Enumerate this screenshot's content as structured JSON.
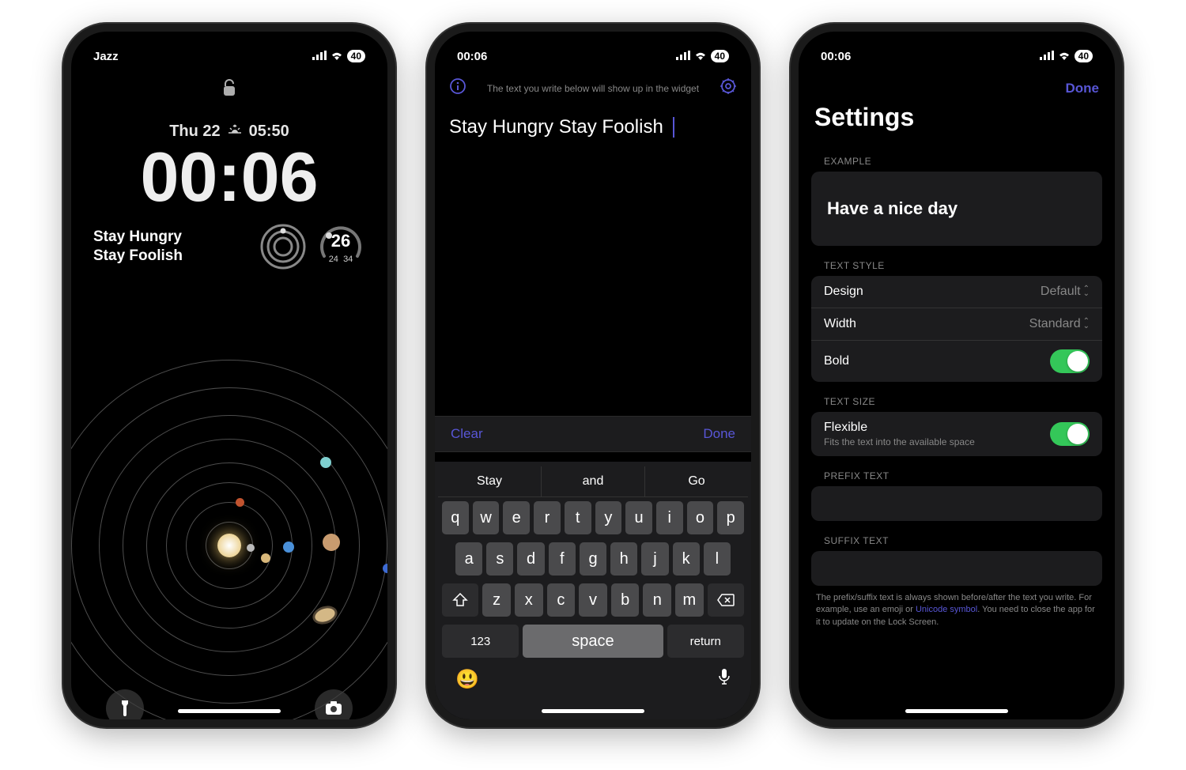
{
  "status": {
    "carrier": "Jazz",
    "time": "00:06",
    "battery": "40"
  },
  "lockscreen": {
    "date": "Thu 22",
    "sunrise": "05:50",
    "time": "00:06",
    "widget_text_l1": "Stay Hungry",
    "widget_text_l2": "Stay Foolish ",
    "gauge": {
      "main": "26",
      "low": "24",
      "high": "34"
    }
  },
  "editor": {
    "hint": "The text you write below will show up in the widget",
    "text": "Stay Hungry Stay Foolish ",
    "toolbar": {
      "clear": "Clear",
      "done": "Done"
    },
    "suggestions": [
      "Stay",
      "and",
      "Go"
    ],
    "keys": {
      "row1": [
        "q",
        "w",
        "e",
        "r",
        "t",
        "y",
        "u",
        "i",
        "o",
        "p"
      ],
      "row2": [
        "a",
        "s",
        "d",
        "f",
        "g",
        "h",
        "j",
        "k",
        "l"
      ],
      "row3": [
        "z",
        "x",
        "c",
        "v",
        "b",
        "n",
        "m"
      ],
      "numbers": "123",
      "space": "space",
      "return": "return"
    }
  },
  "settings": {
    "done": "Done",
    "title": "Settings",
    "sections": {
      "example": {
        "header": "EXAMPLE",
        "text": "Have a nice day"
      },
      "textstyle": {
        "header": "TEXT STYLE",
        "design": {
          "label": "Design",
          "value": "Default"
        },
        "width": {
          "label": "Width",
          "value": "Standard"
        },
        "bold": {
          "label": "Bold",
          "on": true
        }
      },
      "textsize": {
        "header": "TEXT SIZE",
        "flexible": {
          "label": "Flexible",
          "sub": "Fits the text into the available space",
          "on": true
        }
      },
      "prefix": {
        "header": "PREFIX TEXT"
      },
      "suffix": {
        "header": "SUFFIX TEXT"
      }
    },
    "footer": {
      "pre": "The prefix/suffix text is always shown before/after the text you write. For example, use an emoji or ",
      "link": "Unicode symbol",
      "post": ". You need to close the app for it to update on the Lock Screen."
    }
  }
}
